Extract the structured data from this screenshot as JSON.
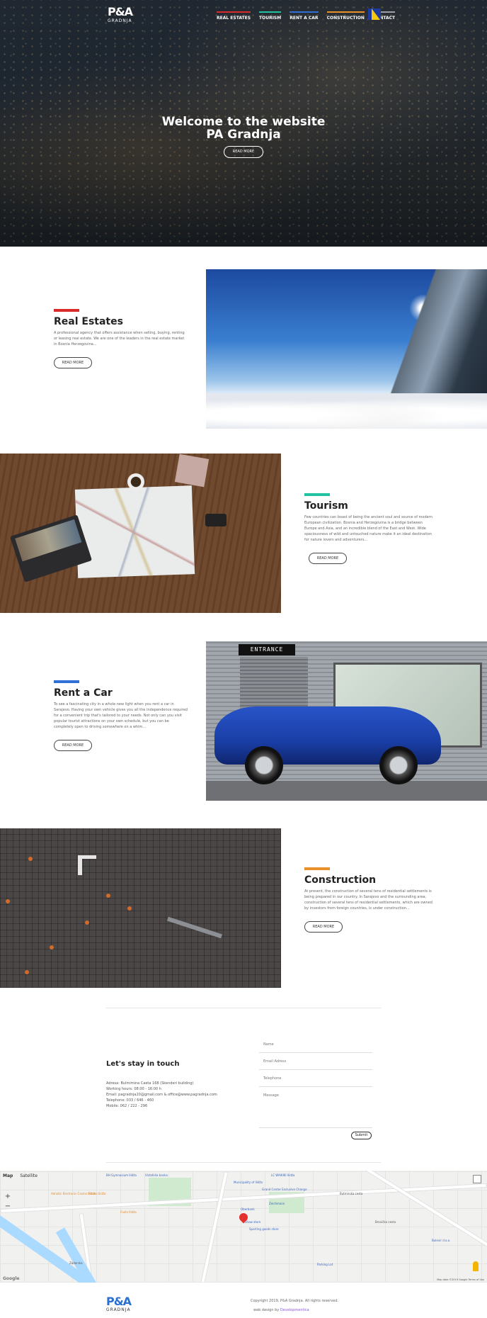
{
  "logo": {
    "mark": "P&A",
    "sub": "GRADNJA"
  },
  "nav": [
    {
      "label": "REAL ESTATES",
      "color": "#d92b2b"
    },
    {
      "label": "TOURISM",
      "color": "#22c1a0"
    },
    {
      "label": "RENT A CAR",
      "color": "#2f6fd6"
    },
    {
      "label": "CONSTRUCTION",
      "color": "#e8902c"
    },
    {
      "label": "CONTACT",
      "color": "#9aa0a6"
    }
  ],
  "hero": {
    "title_line1": "Welcome to the website",
    "title_line2": "PA Gradnja",
    "button": "READ MORE"
  },
  "sections": [
    {
      "title": "Real Estates",
      "color": "#d92b2b",
      "desc": "A professional agency that offers assistance when selling, buying, renting or leasing real estate. We are one of the leaders in the real estate market in Bosnia Herzegovina...",
      "button": "READ MORE"
    },
    {
      "title": "Tourism",
      "color": "#22c1a0",
      "desc": "Few countries can boast of being the ancient soul and source of modern European civilization. Bosnia and Herzegovina is a bridge between Europe and Asia, and an incredible blend of the East and West. Wide spaciousness of wild and untouched nature make it an ideal destination for nature lovers and adventurers...",
      "button": "READ MORE"
    },
    {
      "title": "Rent a Car",
      "color": "#2f6fd6",
      "desc": "To see a fascinating city in a whole new light when you rent a car in Sarajevo. Having your own vehicle gives you all the independence required for a convenient trip that's tailored to your needs. Not only can you visit popular tourist attractions on your own schedule, but you can be completely open to driving somewhere on a whim...",
      "button": "READ MORE"
    },
    {
      "title": "Construction",
      "color": "#e8902c",
      "desc": "At present, the construction of several tens of residential settlements is being prepared in our country. In Sarajevo and the surrounding area, construction of several tens of residential settlements, which are owned by investors from foreign countries, is under construction...",
      "button": "READ MORE"
    }
  ],
  "image_texts": {
    "entrance": "ENTRANCE"
  },
  "contact": {
    "title": "Let's stay in touch",
    "address": "Adresa: Bulmimina Caeta 168 (Skenderi building)",
    "hours": "Working hours: 08:00 - 16:00 h",
    "email": "Email: pagradnja20@gmail.com & office@www.pagradnja.com",
    "phone": "Telephone: 033 / 646 - 460",
    "mobile": "Mobile: 062 / 222 - 296",
    "fields": {
      "name": "Name",
      "email": "Email Adress",
      "telephone": "Telephone",
      "message": "Message"
    },
    "submit": "Submit"
  },
  "map": {
    "tabs": [
      "Map",
      "Satellite"
    ],
    "zoom_in": "+",
    "zoom_out": "−",
    "pois": [
      "BH Gymnasium Ilidža",
      "Vistafolia banka",
      "LC WAIKIKI Ilidža",
      "Municipality of Ilidža",
      "Adriatic Electronic Casino Ilidža",
      "Grand Center Exclusive Change",
      "Studio Ilidža",
      "Zeichmann",
      "Oberbank",
      "Show store",
      "Sporting goods store",
      "Bulevir d.o.o.",
      "Parking Lot",
      "Fruits Ilidža",
      "Brovićka cesta",
      "Butmirska cesta",
      "Zadarska"
    ],
    "credit": "Map data ©2019 Google   Terms of Use",
    "google": "Google"
  },
  "footer": {
    "copyright": "Copyright 2019, P&A Gradnja. All rights reserved.",
    "design_prefix": "web design by ",
    "design_brand": "Developmentica"
  }
}
